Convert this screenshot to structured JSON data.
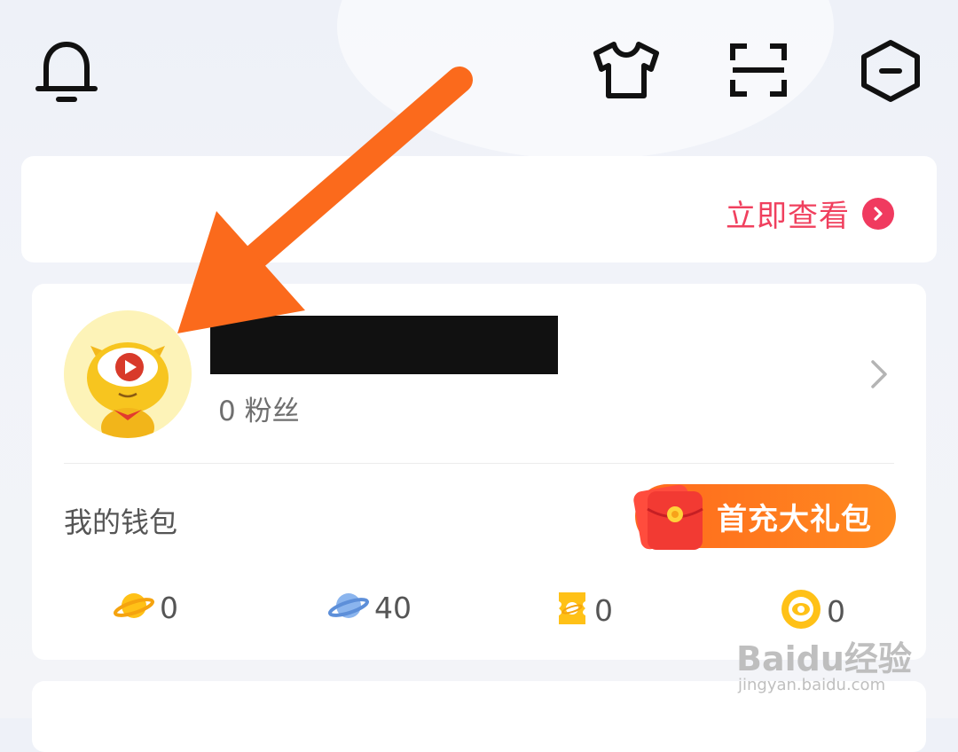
{
  "toolbar": {
    "icons": [
      "bell-icon",
      "tshirt-icon",
      "scan-icon",
      "hexagon-minus-icon"
    ]
  },
  "banner": {
    "link_label": "立即查看"
  },
  "profile": {
    "fans_label": "0 粉丝"
  },
  "wallet": {
    "title": "我的钱包",
    "promo_label": "首充大礼包",
    "stats": [
      {
        "icon": "gold-planet-icon",
        "value": "0"
      },
      {
        "icon": "blue-planet-icon",
        "value": "40"
      },
      {
        "icon": "ticket-icon",
        "value": "0"
      },
      {
        "icon": "eye-coin-icon",
        "value": "0"
      }
    ]
  },
  "watermark": {
    "brand": "Baidu经验",
    "url": "jingyan.baidu.com"
  },
  "colors": {
    "accent_pink": "#f0405e",
    "promo_orange": "#ff7a1e",
    "arrow_orange": "#fb6a1c"
  }
}
